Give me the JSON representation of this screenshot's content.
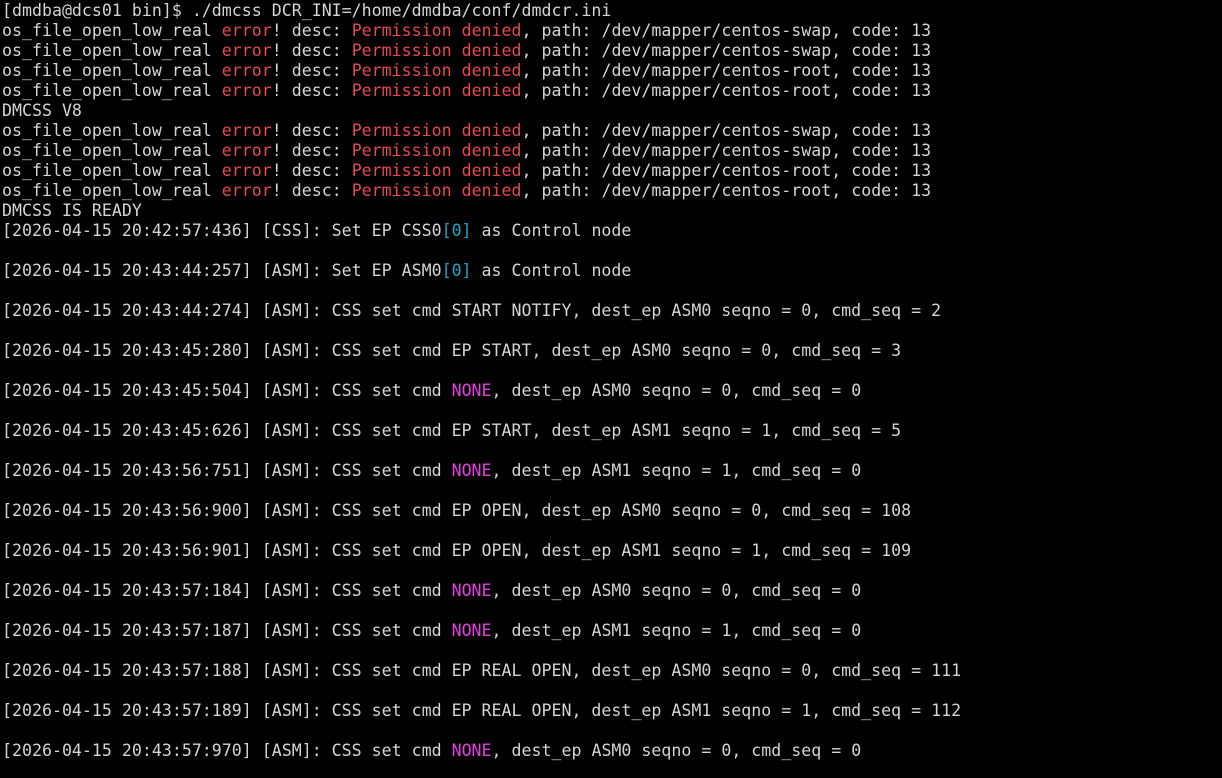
{
  "colors": {
    "background": "#000000",
    "text": "#d4d4d4",
    "error": "#e5484d",
    "none_highlight": "#e040e0",
    "index_highlight": "#1aa3c8"
  },
  "lines": [
    {
      "segments": [
        {
          "t": "[dmdba@dcs01 bin]$ ./dmcss DCR_INI=/home/dmdba/conf/dmdcr.ini"
        }
      ]
    },
    {
      "segments": [
        {
          "t": "os_file_open_low_real "
        },
        {
          "t": "error",
          "c": "red"
        },
        {
          "t": "! desc: "
        },
        {
          "t": "Permission denied",
          "c": "red"
        },
        {
          "t": ", path: /dev/mapper/centos-swap, code: 13"
        }
      ]
    },
    {
      "segments": [
        {
          "t": "os_file_open_low_real "
        },
        {
          "t": "error",
          "c": "red"
        },
        {
          "t": "! desc: "
        },
        {
          "t": "Permission denied",
          "c": "red"
        },
        {
          "t": ", path: /dev/mapper/centos-swap, code: 13"
        }
      ]
    },
    {
      "segments": [
        {
          "t": "os_file_open_low_real "
        },
        {
          "t": "error",
          "c": "red"
        },
        {
          "t": "! desc: "
        },
        {
          "t": "Permission denied",
          "c": "red"
        },
        {
          "t": ", path: /dev/mapper/centos-root, code: 13"
        }
      ]
    },
    {
      "segments": [
        {
          "t": "os_file_open_low_real "
        },
        {
          "t": "error",
          "c": "red"
        },
        {
          "t": "! desc: "
        },
        {
          "t": "Permission denied",
          "c": "red"
        },
        {
          "t": ", path: /dev/mapper/centos-root, code: 13"
        }
      ]
    },
    {
      "segments": [
        {
          "t": "DMCSS V8"
        }
      ]
    },
    {
      "segments": [
        {
          "t": "os_file_open_low_real "
        },
        {
          "t": "error",
          "c": "red"
        },
        {
          "t": "! desc: "
        },
        {
          "t": "Permission denied",
          "c": "red"
        },
        {
          "t": ", path: /dev/mapper/centos-swap, code: 13"
        }
      ]
    },
    {
      "segments": [
        {
          "t": "os_file_open_low_real "
        },
        {
          "t": "error",
          "c": "red"
        },
        {
          "t": "! desc: "
        },
        {
          "t": "Permission denied",
          "c": "red"
        },
        {
          "t": ", path: /dev/mapper/centos-swap, code: 13"
        }
      ]
    },
    {
      "segments": [
        {
          "t": "os_file_open_low_real "
        },
        {
          "t": "error",
          "c": "red"
        },
        {
          "t": "! desc: "
        },
        {
          "t": "Permission denied",
          "c": "red"
        },
        {
          "t": ", path: /dev/mapper/centos-root, code: 13"
        }
      ]
    },
    {
      "segments": [
        {
          "t": "os_file_open_low_real "
        },
        {
          "t": "error",
          "c": "red"
        },
        {
          "t": "! desc: "
        },
        {
          "t": "Permission denied",
          "c": "red"
        },
        {
          "t": ", path: /dev/mapper/centos-root, code: 13"
        }
      ]
    },
    {
      "segments": [
        {
          "t": "DMCSS IS READY"
        }
      ]
    },
    {
      "segments": [
        {
          "t": "[2026-04-15 20:42:57:436] [CSS]: Set EP CSS0"
        },
        {
          "t": "[0]",
          "c": "cyan"
        },
        {
          "t": " as Control node"
        }
      ]
    },
    {
      "segments": []
    },
    {
      "segments": [
        {
          "t": "[2026-04-15 20:43:44:257] [ASM]: Set EP ASM0"
        },
        {
          "t": "[0]",
          "c": "cyan"
        },
        {
          "t": " as Control node"
        }
      ]
    },
    {
      "segments": []
    },
    {
      "segments": [
        {
          "t": "[2026-04-15 20:43:44:274] [ASM]: CSS set cmd START NOTIFY, dest_ep ASM0 seqno = 0, cmd_seq = 2"
        }
      ]
    },
    {
      "segments": []
    },
    {
      "segments": [
        {
          "t": "[2026-04-15 20:43:45:280] [ASM]: CSS set cmd EP START, dest_ep ASM0 seqno = 0, cmd_seq = 3"
        }
      ]
    },
    {
      "segments": []
    },
    {
      "segments": [
        {
          "t": "[2026-04-15 20:43:45:504] [ASM]: CSS set cmd "
        },
        {
          "t": "NONE",
          "c": "magenta"
        },
        {
          "t": ", dest_ep ASM0 seqno = 0, cmd_seq = 0"
        }
      ]
    },
    {
      "segments": []
    },
    {
      "segments": [
        {
          "t": "[2026-04-15 20:43:45:626] [ASM]: CSS set cmd EP START, dest_ep ASM1 seqno = 1, cmd_seq = 5"
        }
      ]
    },
    {
      "segments": []
    },
    {
      "segments": [
        {
          "t": "[2026-04-15 20:43:56:751] [ASM]: CSS set cmd "
        },
        {
          "t": "NONE",
          "c": "magenta"
        },
        {
          "t": ", dest_ep ASM1 seqno = 1, cmd_seq = 0"
        }
      ]
    },
    {
      "segments": []
    },
    {
      "segments": [
        {
          "t": "[2026-04-15 20:43:56:900] [ASM]: CSS set cmd EP OPEN, dest_ep ASM0 seqno = 0, cmd_seq = 108"
        }
      ]
    },
    {
      "segments": []
    },
    {
      "segments": [
        {
          "t": "[2026-04-15 20:43:56:901] [ASM]: CSS set cmd EP OPEN, dest_ep ASM1 seqno = 1, cmd_seq = 109"
        }
      ]
    },
    {
      "segments": []
    },
    {
      "segments": [
        {
          "t": "[2026-04-15 20:43:57:184] [ASM]: CSS set cmd "
        },
        {
          "t": "NONE",
          "c": "magenta"
        },
        {
          "t": ", dest_ep ASM0 seqno = 0, cmd_seq = 0"
        }
      ]
    },
    {
      "segments": []
    },
    {
      "segments": [
        {
          "t": "[2026-04-15 20:43:57:187] [ASM]: CSS set cmd "
        },
        {
          "t": "NONE",
          "c": "magenta"
        },
        {
          "t": ", dest_ep ASM1 seqno = 1, cmd_seq = 0"
        }
      ]
    },
    {
      "segments": []
    },
    {
      "segments": [
        {
          "t": "[2026-04-15 20:43:57:188] [ASM]: CSS set cmd EP REAL OPEN, dest_ep ASM0 seqno = 0, cmd_seq = 111"
        }
      ]
    },
    {
      "segments": []
    },
    {
      "segments": [
        {
          "t": "[2026-04-15 20:43:57:189] [ASM]: CSS set cmd EP REAL OPEN, dest_ep ASM1 seqno = 1, cmd_seq = 112"
        }
      ]
    },
    {
      "segments": []
    },
    {
      "segments": [
        {
          "t": "[2026-04-15 20:43:57:970] [ASM]: CSS set cmd "
        },
        {
          "t": "NONE",
          "c": "magenta"
        },
        {
          "t": ", dest_ep ASM0 seqno = 0, cmd_seq = 0"
        }
      ]
    }
  ]
}
